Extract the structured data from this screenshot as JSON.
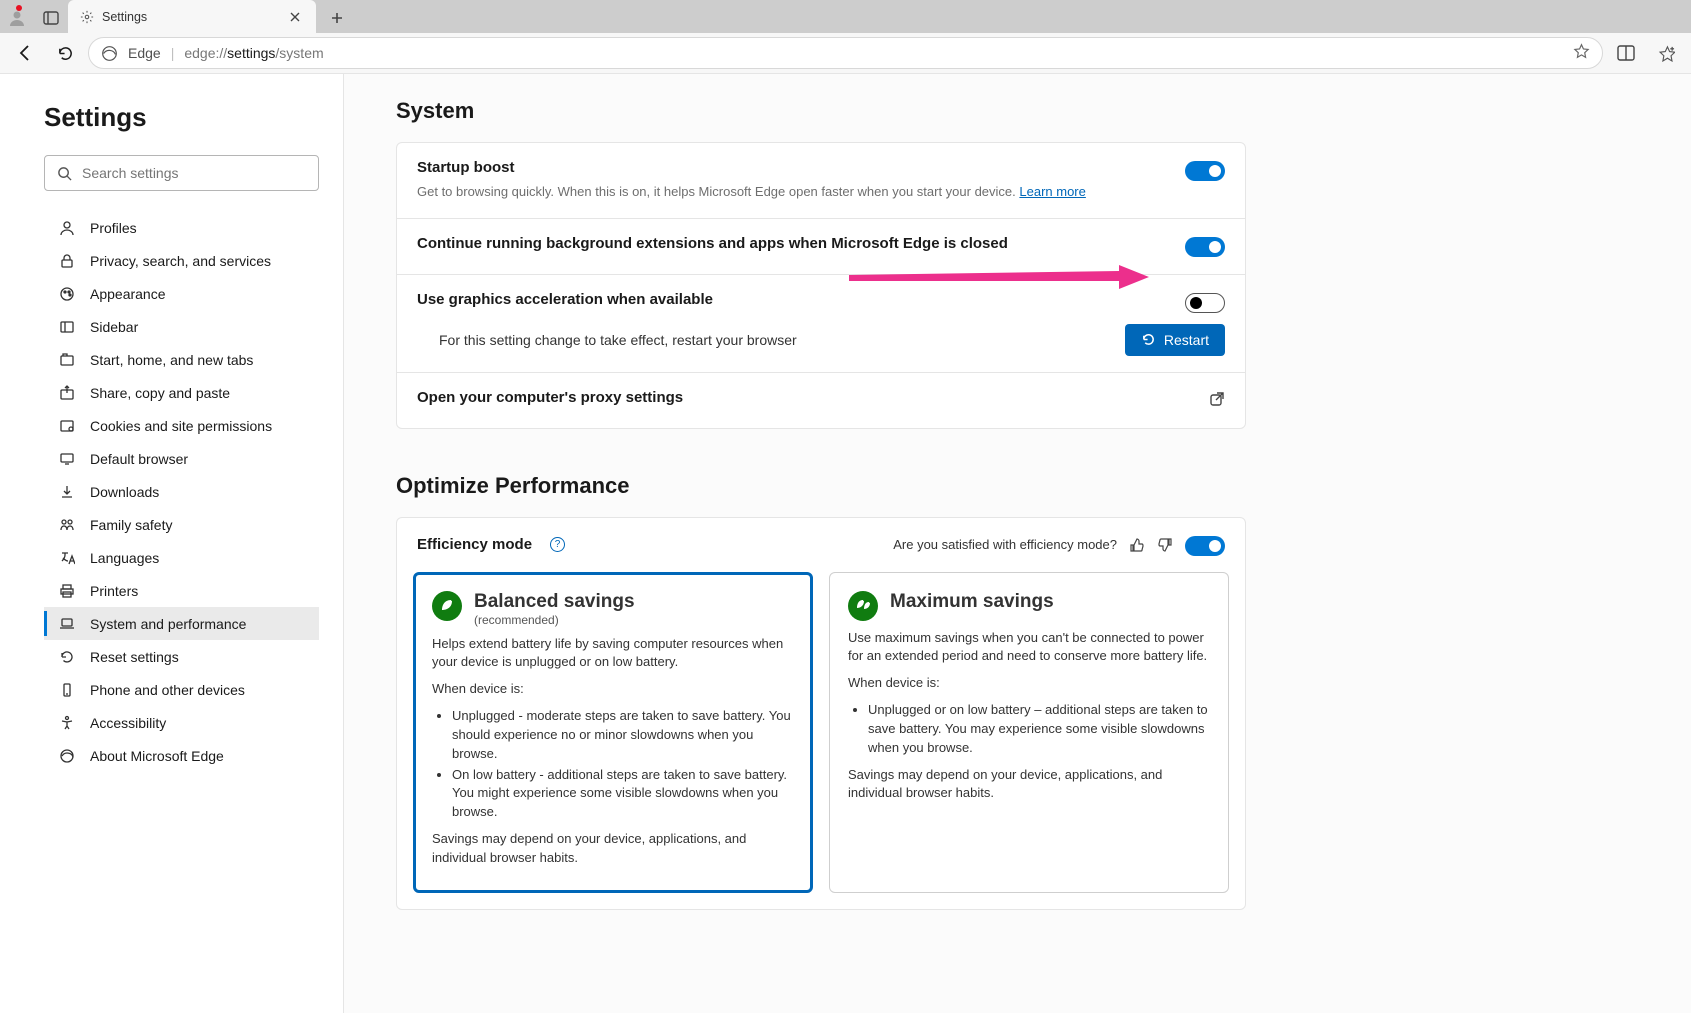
{
  "browser": {
    "tab_title": "Settings",
    "edge_label": "Edge",
    "url_prefix": "edge://",
    "url_strong": "settings",
    "url_rest": "/system"
  },
  "sidebar": {
    "heading": "Settings",
    "search_placeholder": "Search settings",
    "items": [
      {
        "label": "Profiles",
        "icon": "person"
      },
      {
        "label": "Privacy, search, and services",
        "icon": "lock"
      },
      {
        "label": "Appearance",
        "icon": "brush"
      },
      {
        "label": "Sidebar",
        "icon": "sidebar"
      },
      {
        "label": "Start, home, and new tabs",
        "icon": "tabs"
      },
      {
        "label": "Share, copy and paste",
        "icon": "share"
      },
      {
        "label": "Cookies and site permissions",
        "icon": "cookie"
      },
      {
        "label": "Default browser",
        "icon": "screen"
      },
      {
        "label": "Downloads",
        "icon": "download"
      },
      {
        "label": "Family safety",
        "icon": "family"
      },
      {
        "label": "Languages",
        "icon": "language"
      },
      {
        "label": "Printers",
        "icon": "printer"
      },
      {
        "label": "System and performance",
        "icon": "laptop",
        "selected": true
      },
      {
        "label": "Reset settings",
        "icon": "reset"
      },
      {
        "label": "Phone and other devices",
        "icon": "phone"
      },
      {
        "label": "Accessibility",
        "icon": "accessibility"
      },
      {
        "label": "About Microsoft Edge",
        "icon": "edge"
      }
    ]
  },
  "main": {
    "system_heading": "System",
    "startup": {
      "title": "Startup boost",
      "desc": "Get to browsing quickly. When this is on, it helps Microsoft Edge open faster when you start your device. ",
      "learn_more": "Learn more",
      "on": true
    },
    "background": {
      "title": "Continue running background extensions and apps when Microsoft Edge is closed",
      "on": true
    },
    "gpu": {
      "title": "Use graphics acceleration when available",
      "on": false,
      "restart_note": "For this setting change to take effect, restart your browser",
      "restart_label": "Restart"
    },
    "proxy": {
      "title": "Open your computer's proxy settings"
    },
    "perf_heading": "Optimize Performance",
    "efficiency": {
      "title": "Efficiency mode",
      "feedback_prompt": "Are you satisfied with efficiency mode?",
      "on": true,
      "balanced": {
        "title": "Balanced savings",
        "rec": "(recommended)",
        "desc1": "Helps extend battery life by saving computer resources when your device is unplugged or on low battery.",
        "when_label": "When device is:",
        "bullet1": "Unplugged - moderate steps are taken to save battery. You should experience no or minor slowdowns when you browse.",
        "bullet2": "On low battery - additional steps are taken to save battery. You might experience some visible slowdowns when you browse.",
        "footer": "Savings may depend on your device, applications, and individual browser habits."
      },
      "maximum": {
        "title": "Maximum savings",
        "desc1": "Use maximum savings when you can't be connected to power for an extended period and need to conserve more battery life.",
        "when_label": "When device is:",
        "bullet1": "Unplugged or on low battery – additional steps are taken to save battery. You may experience some visible slowdowns when you browse.",
        "footer": "Savings may depend on your device, applications, and individual browser habits."
      }
    }
  },
  "colors": {
    "accent": "#0078d4",
    "link": "#0067b8",
    "green": "#107c10",
    "arrow": "#ec2f8c"
  }
}
